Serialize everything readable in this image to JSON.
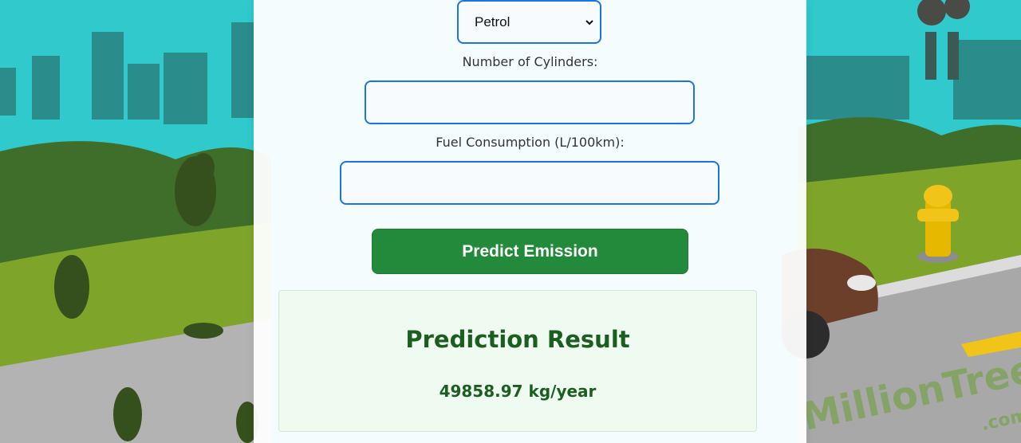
{
  "form": {
    "fuel_type": {
      "selected": "Petrol"
    },
    "cylinders": {
      "label": "Number of Cylinders:",
      "value": ""
    },
    "fuel_consumption": {
      "label": "Fuel Consumption (L/100km):",
      "value": ""
    },
    "predict_button": "Predict Emission"
  },
  "result": {
    "title": "Prediction Result",
    "value": "49858.97 kg/year"
  },
  "background": {
    "watermark": "MillionTrees.com"
  },
  "colors": {
    "sky": "#2fc9cc",
    "accent_button": "#228a3a",
    "input_border": "#1a73e8",
    "result_text": "#1b5e20"
  }
}
